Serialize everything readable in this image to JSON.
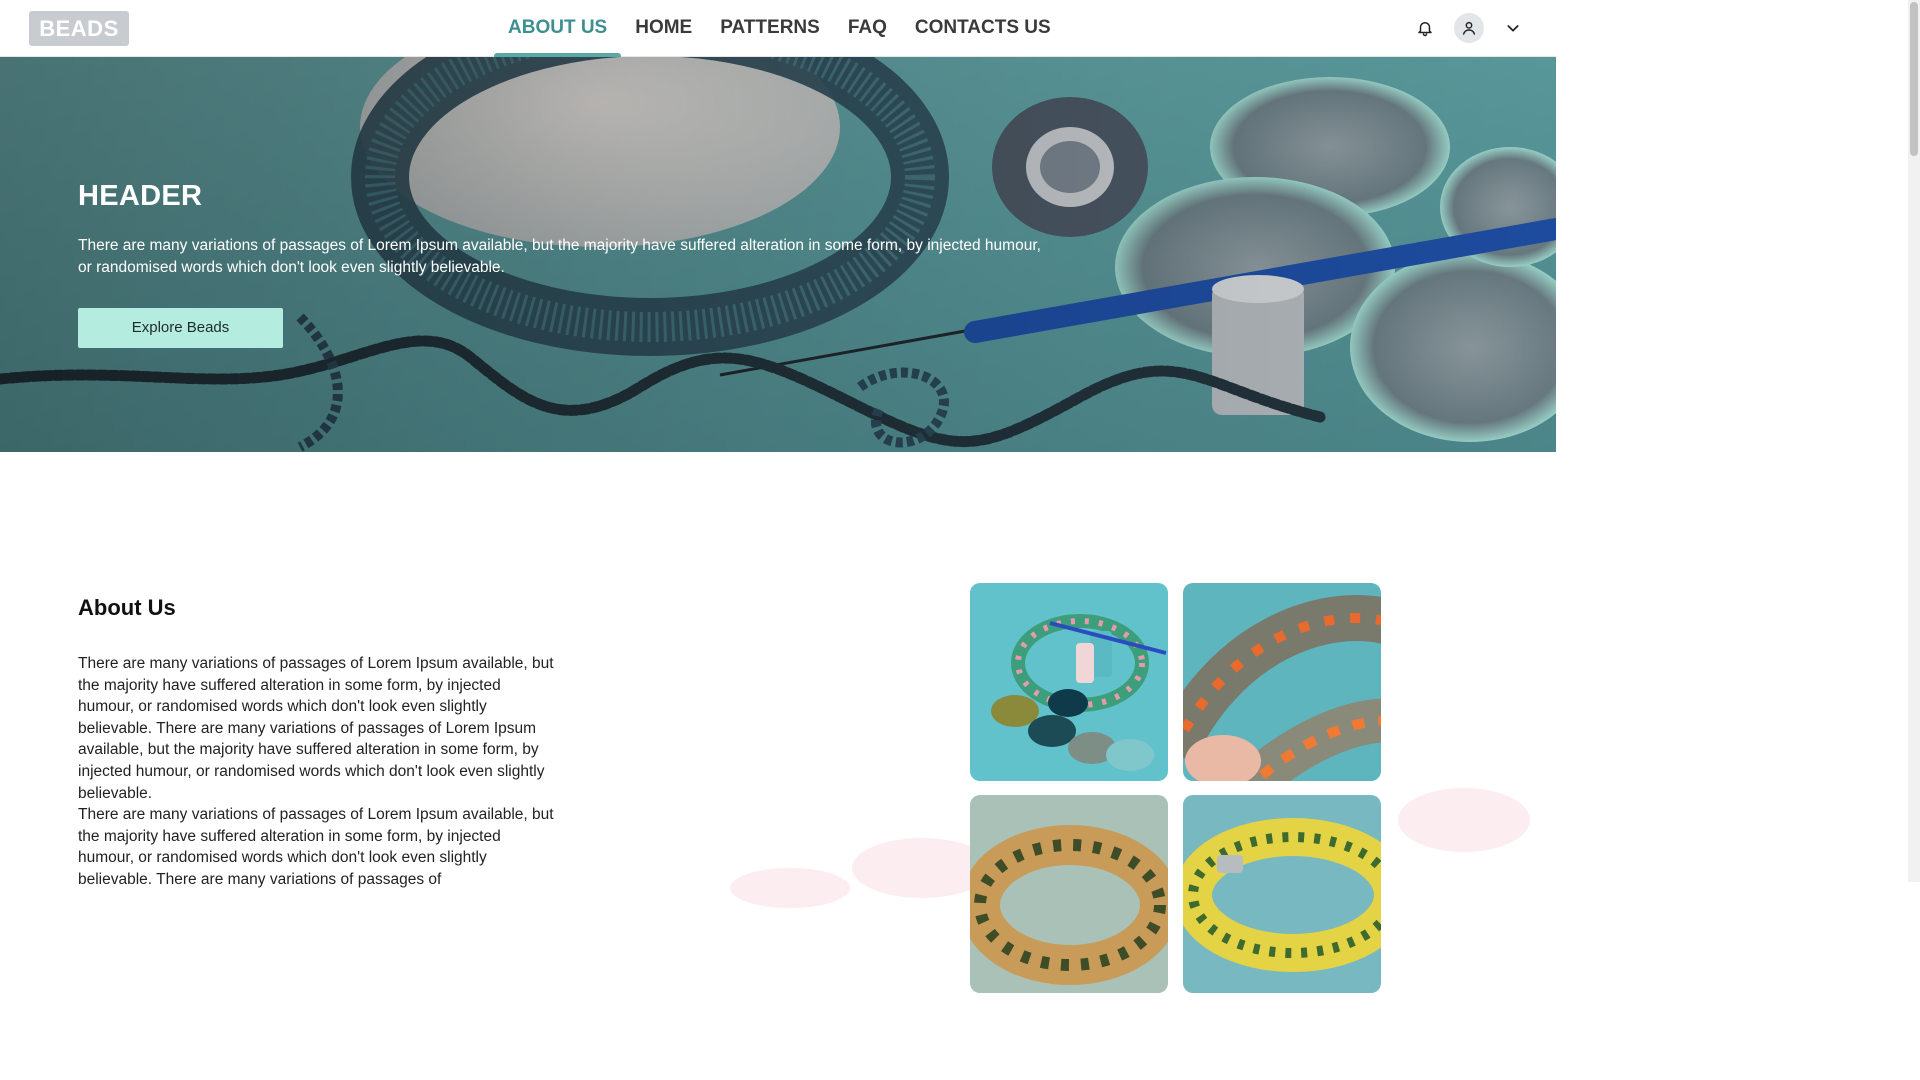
{
  "brand": {
    "logo_text": "BEADS"
  },
  "nav": {
    "items": [
      {
        "label": "ABOUT US",
        "active": true
      },
      {
        "label": "HOME",
        "active": false
      },
      {
        "label": "PATTERNS",
        "active": false
      },
      {
        "label": "FAQ",
        "active": false
      },
      {
        "label": "CONTACTS US",
        "active": false
      }
    ]
  },
  "header_actions": {
    "notification_icon": "bell-icon",
    "profile_icon": "user-icon",
    "menu_icon": "chevron-down-icon"
  },
  "hero": {
    "title": "HEADER",
    "text": "There are many variations of passages of Lorem Ipsum available, but the majority have suffered alteration in some form, by injected humour, or randomised words which don't look even slightly believable.",
    "button_label": "Explore Beads"
  },
  "about": {
    "title": "About Us",
    "paragraphs": [
      "There are many variations of passages of Lorem Ipsum available, but the majority have suffered alteration in some form, by injected humour, or randomised words which don't look even slightly believable. There are many variations of passages of Lorem Ipsum available, but the majority have suffered alteration in some form, by injected humour, or randomised words which don't look even slightly believable.",
      "There are many variations of passages of Lorem Ipsum available, but the majority have suffered alteration in some form, by injected humour, or randomised words which don't look even slightly believable. There are many variations of passages of"
    ]
  },
  "colors": {
    "accent": "#3f8f91",
    "button": "#b4ece0",
    "hero_tint": "#5f9ea1"
  }
}
